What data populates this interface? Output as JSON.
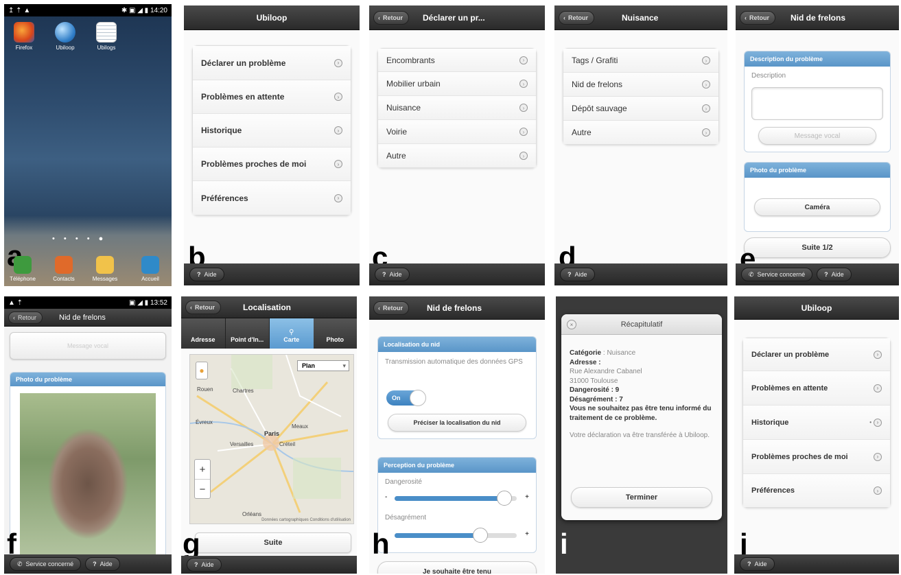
{
  "panels": {
    "a": {
      "letter": "a",
      "status_left": "↥ ⇡ ▲",
      "status_right": "✱ ▣ ◢ ▮ 14:20",
      "apps": [
        {
          "label": "Firefox",
          "icon": "firefox-icon"
        },
        {
          "label": "Ubiloop",
          "icon": "globe-icon"
        },
        {
          "label": "Ubilogs",
          "icon": "notes-icon"
        }
      ],
      "dock": [
        {
          "label": "Téléphone",
          "icon": "phone-icon"
        },
        {
          "label": "Contacts",
          "icon": "contacts-icon"
        },
        {
          "label": "Messages",
          "icon": "envelope-icon"
        },
        {
          "label": "Accueil",
          "icon": "home-icon"
        }
      ],
      "page_dots": "• • • • ●"
    },
    "b": {
      "letter": "b",
      "title": "Ubiloop",
      "items": [
        "Déclarer un problème",
        "Problèmes en attente",
        "Historique",
        "Problèmes proches de moi",
        "Préférences"
      ],
      "help": "Aide"
    },
    "c": {
      "letter": "c",
      "back": "Retour",
      "title": "Déclarer un pr...",
      "items": [
        "Encombrants",
        "Mobilier urbain",
        "Nuisance",
        "Voirie",
        "Autre"
      ],
      "help": "Aide"
    },
    "d": {
      "letter": "d",
      "back": "Retour",
      "title": "Nuisance",
      "items": [
        "Tags / Grafiti",
        "Nid de frelons",
        "Dépôt sauvage",
        "Autre"
      ],
      "help": "Aide"
    },
    "e": {
      "letter": "e",
      "back": "Retour",
      "title": "Nid de frelons",
      "section1": "Description du problème",
      "desc_label": "Description",
      "voice_btn": "Message vocal",
      "section2": "Photo du problème",
      "camera_btn": "Caméra",
      "next_btn": "Suite 1/2",
      "service_btn": "Service concerné",
      "help": "Aide"
    },
    "f": {
      "letter": "f",
      "status_left": "▲ ⇡",
      "status_right": "▣ ◢ ▮ 13:52",
      "back": "Retour",
      "title": "Nid de frelons",
      "voice_btn": "Message vocal",
      "section": "Photo du problème",
      "service_btn": "Service concerné",
      "help": "Aide"
    },
    "g": {
      "letter": "g",
      "back": "Retour",
      "title": "Localisation",
      "tabs": [
        "Adresse",
        "Point d'In...",
        "Carte",
        "Photo"
      ],
      "active_tab": "Carte",
      "map_select": "Plan",
      "map_labels": [
        "Rouen",
        "Évreux",
        "Paris",
        "Versailles",
        "Créteil",
        "Meaux",
        "Orléans",
        "Chartres"
      ],
      "zoom_in": "+",
      "zoom_out": "−",
      "map_credit": "Données cartographiques  Conditions d'utilisation",
      "next_btn": "Suite",
      "help": "Aide"
    },
    "h": {
      "letter": "h",
      "back": "Retour",
      "title": "Nid de frelons",
      "section1": "Localisation du nid",
      "gps_text": "Transmission automatique des données GPS",
      "toggle": "On",
      "locate_btn": "Préciser la localisation du nid",
      "section2": "Perception du problème",
      "danger_label": "Dangerosité",
      "danger_value": 0.9,
      "nuisance_label": "Désagrément",
      "nuisance_value": 0.7,
      "minus": "-",
      "plus": "+",
      "bottom_btn": "Je souhaite être tenu"
    },
    "i": {
      "letter": "i",
      "title": "Récapitulatif",
      "cat_label": "Catégorie",
      "cat_value": ": Nuisance",
      "addr_label": "Adresse :",
      "addr1": "Rue Alexandre Cabanel",
      "addr2": "31000 Toulouse",
      "danger": "Dangerosité : 9",
      "nuisance": "Désagrément : 7",
      "notice": "Vous ne souhaitez pas être tenu informé du traitement de ce problème.",
      "sent": "Votre déclaration va être transférée à Ubiloop.",
      "finish_btn": "Terminer"
    },
    "j": {
      "letter": "j",
      "title": "Ubiloop",
      "items": [
        "Déclarer un problème",
        "Problèmes en attente",
        "Historique",
        "Problèmes proches de moi",
        "Préférences"
      ],
      "help": "Aide"
    }
  }
}
